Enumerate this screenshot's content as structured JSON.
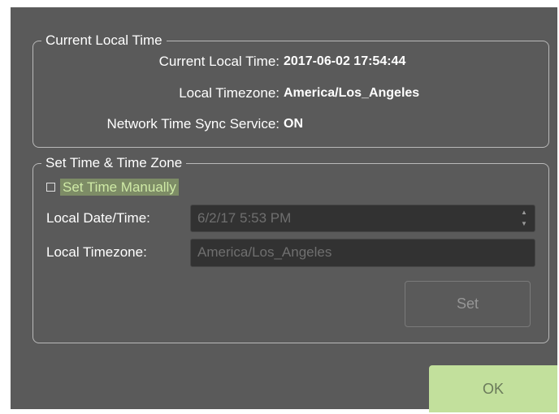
{
  "current_time_group": {
    "legend": "Current Local Time",
    "rows": [
      {
        "label": "Current Local Time:",
        "value": "2017-06-02 17:54:44"
      },
      {
        "label": "Local Timezone:",
        "value": "America/Los_Angeles"
      },
      {
        "label": "Network Time Sync Service:",
        "value": "ON"
      }
    ]
  },
  "set_time_group": {
    "legend": "Set Time & Time Zone",
    "manual_checkbox": {
      "label": "Set Time Manually",
      "checked": false
    },
    "date_time": {
      "label": "Local Date/Time:",
      "value": "6/2/17 5:53 PM"
    },
    "timezone": {
      "label": "Local Timezone:",
      "value": "America/Los_Angeles"
    },
    "set_button": "Set"
  },
  "ok_button": "OK",
  "colors": {
    "dialog_bg": "#5a5a5a",
    "accent": "#c2e09c",
    "checkbox_label_text": "#cfeaa6",
    "disabled_field_bg": "#323232"
  }
}
